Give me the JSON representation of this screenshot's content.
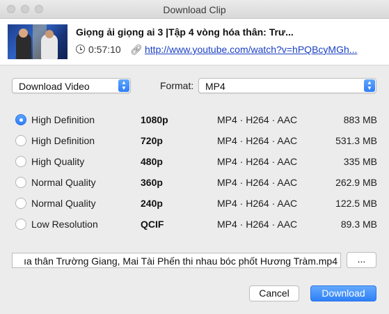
{
  "window": {
    "title": "Download Clip"
  },
  "clip": {
    "title": "Giọng ải giọng ai 3 |Tập 4 vòng hóa thân: Trư...",
    "duration": "0:57:10",
    "url": "http://www.youtube.com/watch?v=hPQBcyMGh..."
  },
  "controls": {
    "mode_selected": "Download Video",
    "format_label": "Format:",
    "format_selected": "MP4"
  },
  "options": [
    {
      "quality": "High Definition",
      "resolution": "1080p",
      "codec": "MP4 · H264 · AAC",
      "size": "883 MB",
      "selected": true
    },
    {
      "quality": "High Definition",
      "resolution": "720p",
      "codec": "MP4 · H264 · AAC",
      "size": "531.3 MB",
      "selected": false
    },
    {
      "quality": "High Quality",
      "resolution": "480p",
      "codec": "MP4 · H264 · AAC",
      "size": "335 MB",
      "selected": false
    },
    {
      "quality": "Normal Quality",
      "resolution": "360p",
      "codec": "MP4 · H264 · AAC",
      "size": "262.9 MB",
      "selected": false
    },
    {
      "quality": "Normal Quality",
      "resolution": "240p",
      "codec": "MP4 · H264 · AAC",
      "size": "122.5 MB",
      "selected": false
    },
    {
      "quality": "Low Resolution",
      "resolution": "QCIF",
      "codec": "MP4 · H264 · AAC",
      "size": "89.3 MB",
      "selected": false
    }
  ],
  "file": {
    "name": "ıa thân  Trường Giang, Mai Tài Phến thi nhau  bóc phốt  Hương Tràm.mp4",
    "browse_label": "..."
  },
  "buttons": {
    "cancel": "Cancel",
    "download": "Download"
  },
  "colors": {
    "accent": "#2f7ef7",
    "link": "#1a3fc4"
  },
  "icons": {
    "duration": "clock-icon",
    "url": "link-icon",
    "popup": "up-down-arrows-icon"
  }
}
